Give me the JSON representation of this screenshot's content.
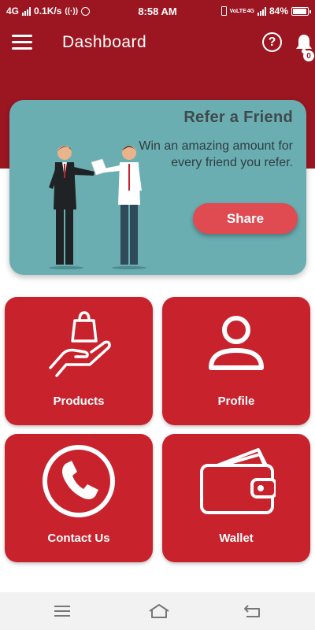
{
  "status_bar": {
    "network": "4G",
    "speed": "0.1K/s",
    "time": "8:58 AM",
    "volte": "VoLTE",
    "network_right": "4G",
    "battery": "84%"
  },
  "app_bar": {
    "title": "Dashboard",
    "notification_count": "0"
  },
  "banner": {
    "title": "Refer a Friend",
    "text": "Win an amazing amount for every friend you refer.",
    "share_label": "Share"
  },
  "tiles": [
    {
      "label": "Products",
      "icon": "shopping-bag-hand-icon"
    },
    {
      "label": "Profile",
      "icon": "user-icon"
    },
    {
      "label": "Contact Us",
      "icon": "phone-icon"
    },
    {
      "label": "Wallet",
      "icon": "wallet-icon"
    }
  ],
  "colors": {
    "primary": "#9c1621",
    "tile": "#c8222d",
    "banner": "#6aaeb2",
    "share": "#e04a51"
  }
}
